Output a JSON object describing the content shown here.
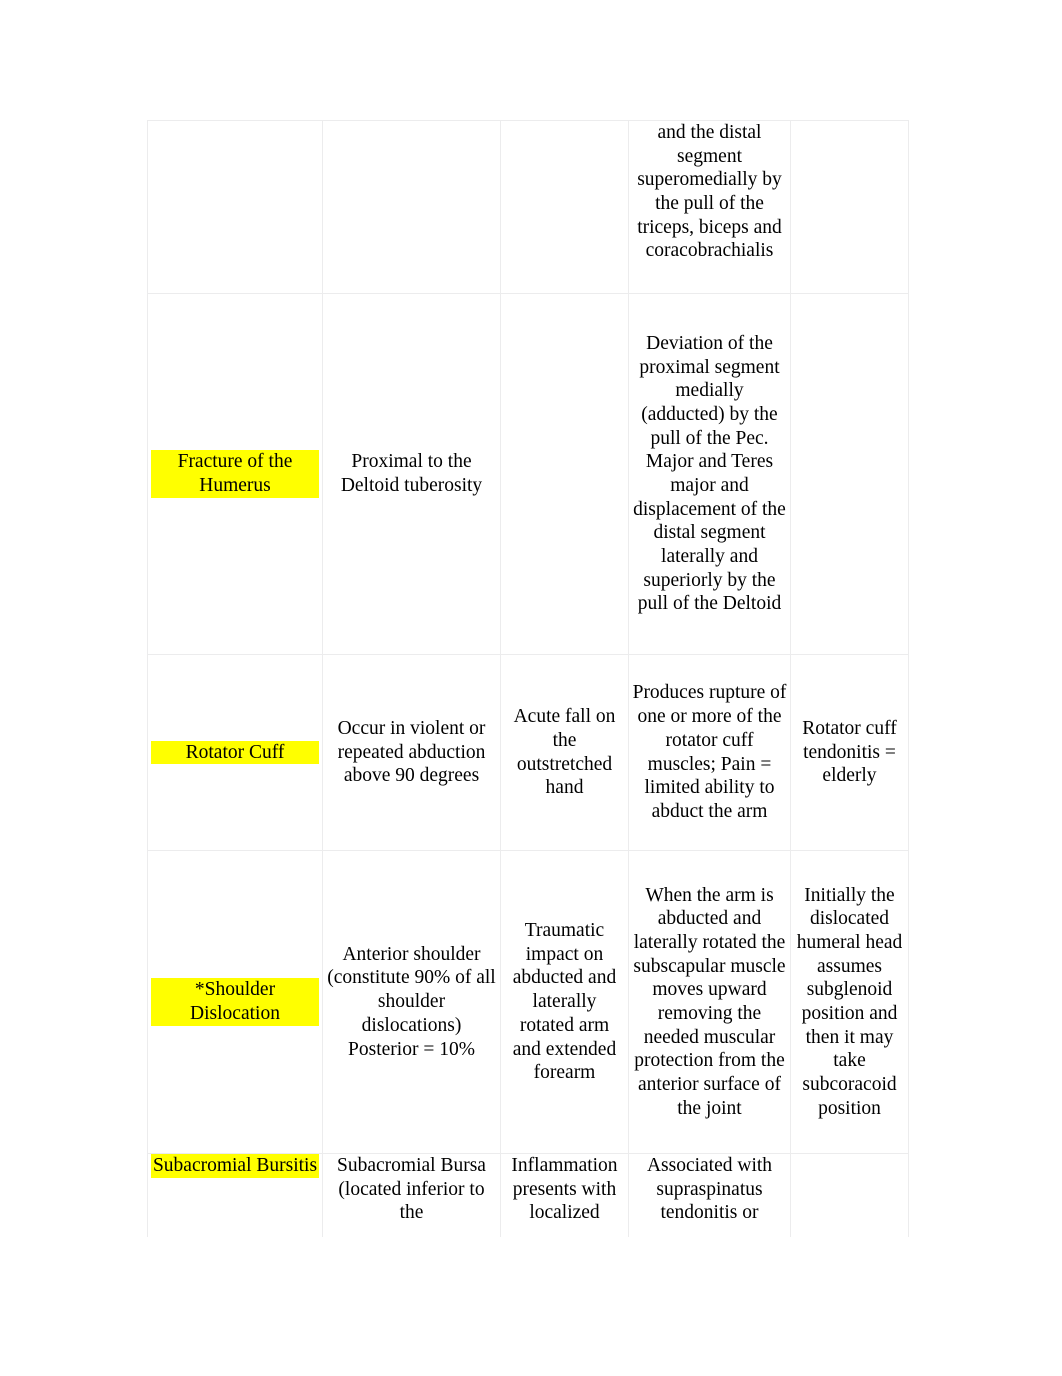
{
  "document": {
    "type": "table",
    "title": "Shoulder pathology comparison table",
    "highlight_color": "#ffff00",
    "border_color": "#ececed",
    "columns": 5
  },
  "table": {
    "rows": [
      {
        "name": "continued-humerus-fracture-row",
        "condition": "",
        "location": "",
        "mechanism": "",
        "description": "and the distal segment superomedially by the pull of the triceps, biceps and coracobrachialis",
        "notes": ""
      },
      {
        "name": "fracture-of-the-humerus-row",
        "condition": "Fracture of the Humerus",
        "condition_highlighted": true,
        "location": "Proximal to the Deltoid tuberosity",
        "mechanism": "",
        "description": "Deviation of the proximal segment medially (adducted) by the pull of the Pec. Major and Teres major and displacement of the distal segment laterally and superiorly by the pull of the Deltoid",
        "notes": ""
      },
      {
        "name": "rotator-cuff-row",
        "condition": "Rotator Cuff",
        "condition_highlighted": true,
        "location": "Occur in violent or repeated abduction above 90 degrees",
        "mechanism": "Acute fall on the outstretched hand",
        "description": "Produces rupture of one or more of the rotator cuff muscles; Pain = limited ability to abduct the arm",
        "notes": "Rotator cuff tendonitis = elderly"
      },
      {
        "name": "shoulder-dislocation-row",
        "condition": "*Shoulder Dislocation",
        "condition_highlighted": true,
        "location": "Anterior shoulder (constitute 90% of all shoulder dislocations) Posterior = 10%",
        "mechanism": "Traumatic impact on abducted and laterally rotated arm and extended forearm",
        "description": "When the arm is abducted and laterally rotated the subscapular muscle moves upward removing the needed muscular protection from the anterior surface of the joint",
        "notes": "Initially the dislocated humeral head assumes subglenoid position and then it may take subcoracoid position"
      },
      {
        "name": "subacromial-bursitis-row",
        "condition": "Subacromial Bursitis",
        "condition_highlighted": true,
        "location": "Subacromial Bursa (located inferior to the",
        "mechanism": "Inflammation presents with localized",
        "description": "Associated with supraspinatus tendonitis or",
        "notes": ""
      }
    ]
  }
}
